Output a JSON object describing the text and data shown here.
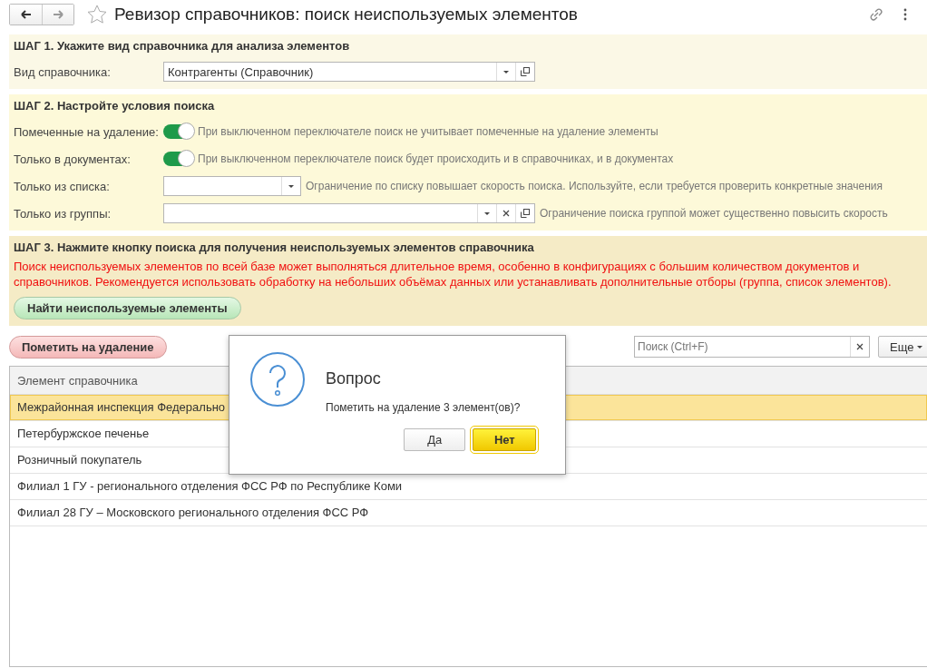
{
  "window": {
    "title": "Ревизор справочников: поиск неиспользуемых элементов",
    "favorite": false
  },
  "steps": [
    {
      "heading": "ШАГ 1. Укажите вид справочника для анализа элементов",
      "rows": [
        {
          "kind": "select",
          "label": "Вид справочника:",
          "value": "Контрагенты (Справочник)"
        }
      ]
    },
    {
      "heading": "ШАГ 2. Настройте условия поиска",
      "rows": [
        {
          "kind": "toggle",
          "label": "Помеченные на удаление:",
          "on": true,
          "hint": "При выключенном переключателе поиск не учитывает помеченные на удаление элементы"
        },
        {
          "kind": "toggle",
          "label": "Только в документах:",
          "on": true,
          "hint": "При выключенном переключателе поиск будет происходить и в справочниках, и в документах"
        },
        {
          "kind": "list",
          "label": "Только из списка:",
          "hint": "Ограничение по списку повышает скорость поиска. Используйте, если требуется проверить конкретные значения"
        },
        {
          "kind": "choice",
          "label": "Только из группы:",
          "hint": "Ограничение поиска группой может существенно повысить скорость"
        }
      ]
    },
    {
      "heading": "ШАГ 3. Нажмите кнопку поиска для получения неиспользуемых элементов справочника",
      "warning": "Поиск неиспользуемых элементов по всей базе может выполняться длительное время, особенно в конфигурациях с большим количеством документов и справочников. Рекомендуется использовать обработку на небольших объёмах данных или устанавливать дополнительные отборы (группа, список элементов).",
      "button": "Найти неиспользуемые элементы"
    }
  ],
  "toolbar": {
    "mark_button": "Пометить на удаление",
    "search_placeholder": "Поиск (Ctrl+F)",
    "more_button": "Еще"
  },
  "table": {
    "columns": [
      "Элемент справочника"
    ],
    "rows": [
      {
        "text": "Межрайонная инспекция Федерально",
        "selected": true
      },
      {
        "text": "Петербуржское печенье",
        "selected": false
      },
      {
        "text": "Розничный покупатель",
        "selected": false
      },
      {
        "text": "Филиал 1 ГУ - регионального отделения ФСС РФ по Республике Коми",
        "selected": false
      },
      {
        "text": "Филиал 28 ГУ – Московского регионального отделения ФСС РФ",
        "selected": false
      }
    ]
  },
  "dialog": {
    "title": "Вопрос",
    "message": "Пометить на удаление 3 элемент(ов)?",
    "buttons": [
      {
        "label": "Да",
        "default": false
      },
      {
        "label": "Нет",
        "default": true
      }
    ]
  }
}
